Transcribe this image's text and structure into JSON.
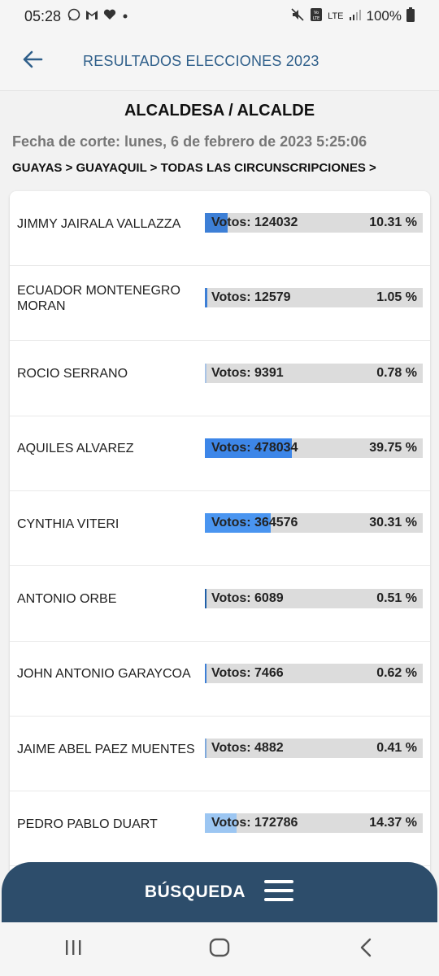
{
  "status_bar": {
    "time": "05:28",
    "battery": "100%",
    "network": "LTE"
  },
  "app_bar": {
    "title": "RESULTADOS ELECCIONES 2023"
  },
  "heading": "ALCALDESA / ALCALDE",
  "fecha_corte": "Fecha de corte: lunes, 6 de febrero de 2023 5:25:06",
  "breadcrumb": "GUAYAS > GUAYAQUIL > TODAS LAS CIRCUNSCRIPCIONES >",
  "candidates": [
    {
      "name": "JIMMY JAIRALA VALLAZZA",
      "votes": "Votos: 124032",
      "percent": "10.31 %",
      "share": 10.31,
      "color": "#3d7fd6"
    },
    {
      "name": "ECUADOR MONTENEGRO MORAN",
      "votes": "Votos: 12579",
      "percent": "1.05 %",
      "share": 1.05,
      "color": "#3d7fd6"
    },
    {
      "name": "ROCIO SERRANO",
      "votes": "Votos: 9391",
      "percent": "0.78 %",
      "share": 0.78,
      "color": "#a9c4e6"
    },
    {
      "name": "AQUILES ALVAREZ",
      "votes": "Votos: 478034",
      "percent": "39.75 %",
      "share": 39.75,
      "color": "#3d86e8"
    },
    {
      "name": "CYNTHIA VITERI",
      "votes": "Votos: 364576",
      "percent": "30.31 %",
      "share": 30.31,
      "color": "#4a95f0"
    },
    {
      "name": "ANTONIO ORBE",
      "votes": "Votos: 6089",
      "percent": "0.51 %",
      "share": 0.51,
      "color": "#1f5fa8"
    },
    {
      "name": "JOHN ANTONIO GARAYCOA",
      "votes": "Votos: 7466",
      "percent": "0.62 %",
      "share": 0.62,
      "color": "#3d7fd6"
    },
    {
      "name": "JAIME ABEL PAEZ MUENTES",
      "votes": "Votos: 4882",
      "percent": "0.41 %",
      "share": 0.41,
      "color": "#7fa9dc"
    },
    {
      "name": "PEDRO PABLO DUART",
      "votes": "Votos: 172786",
      "percent": "14.37 %",
      "share": 14.37,
      "color": "#9cc6f2"
    }
  ],
  "search_button": {
    "label": "BÚSQUEDA",
    "icon": "hamburger-menu-icon"
  },
  "nav": {
    "recents_icon": "recents-icon",
    "home_icon": "home-icon",
    "back_icon": "back-icon"
  },
  "colors": {
    "app_title": "#2f5f8a",
    "search_bar": "#2d4d6b",
    "bar_track": "#dcdcdc"
  }
}
